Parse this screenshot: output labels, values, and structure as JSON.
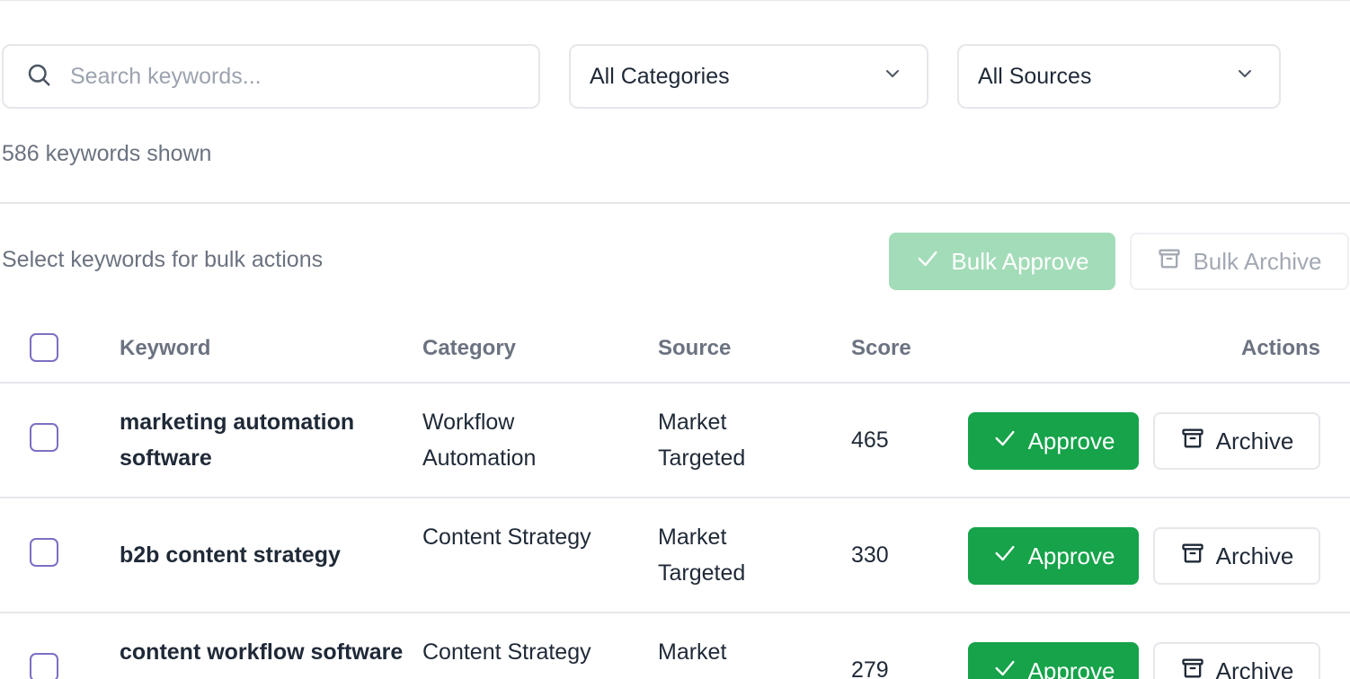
{
  "filters": {
    "search_placeholder": "Search keywords...",
    "category_selected": "All Categories",
    "source_selected": "All Sources"
  },
  "count_text": "586 keywords shown",
  "bulk": {
    "hint": "Select keywords for bulk actions",
    "approve_label": "Bulk Approve",
    "archive_label": "Bulk Archive"
  },
  "table": {
    "headers": {
      "keyword": "Keyword",
      "category": "Category",
      "source": "Source",
      "score": "Score",
      "actions": "Actions"
    },
    "approve_label": "Approve",
    "archive_label": "Archive",
    "rows": [
      {
        "keyword": "marketing automation software",
        "category": "Workflow Automation",
        "source": "Market Targeted",
        "score": "465"
      },
      {
        "keyword": "b2b content strategy",
        "category": "Content Strategy",
        "source": "Market Targeted",
        "score": "330"
      },
      {
        "keyword": "content workflow software",
        "category": "Content Strategy",
        "source": "Market Targeted",
        "score": "279"
      }
    ]
  },
  "colors": {
    "approve": "#16a34a",
    "approve_disabled": "#a3dcb8",
    "checkbox_border": "#7c6fc4",
    "border": "#e5e7eb"
  }
}
